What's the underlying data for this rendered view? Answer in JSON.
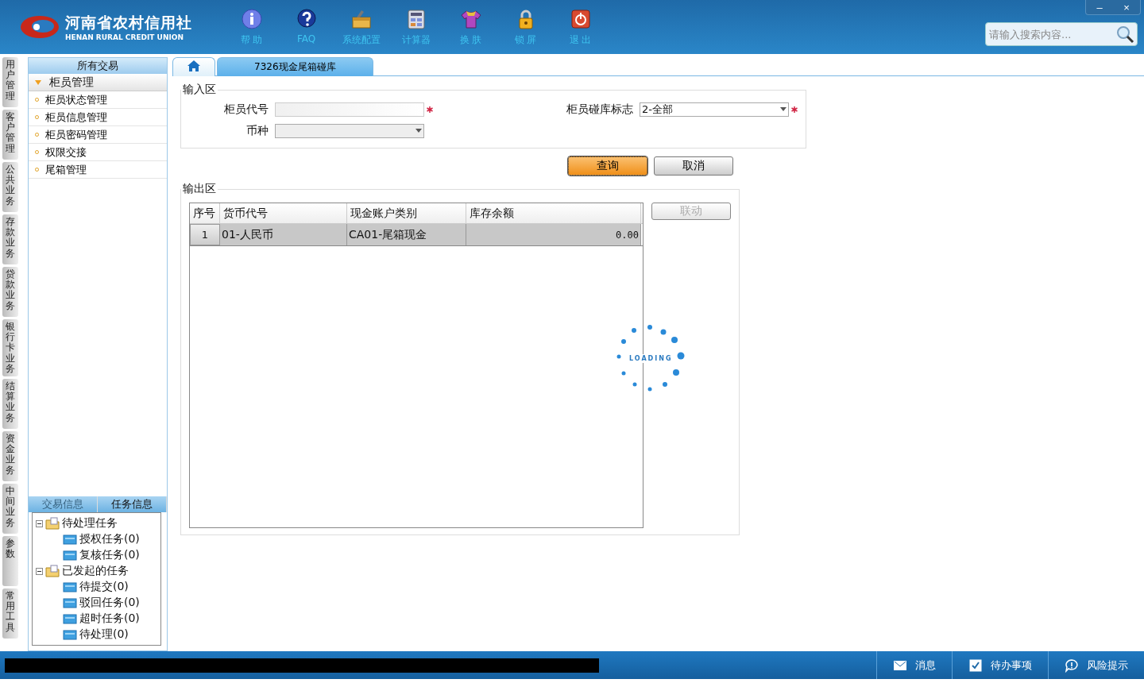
{
  "header": {
    "logo_title": "河南省农村信用社",
    "logo_subtitle": "HENAN RURAL CREDIT UNION",
    "toolbar": [
      {
        "kind": "info",
        "label": "帮 助"
      },
      {
        "kind": "faq",
        "label": "FAQ"
      },
      {
        "kind": "toolbox",
        "label": "系统配置"
      },
      {
        "kind": "calculator",
        "label": "计算器"
      },
      {
        "kind": "shirt",
        "label": "换 肤"
      },
      {
        "kind": "lock",
        "label": "锁 屏"
      },
      {
        "kind": "power",
        "label": "退 出"
      }
    ],
    "search": {
      "placeholder": "请输入搜索内容..."
    },
    "window_buttons": [
      "–",
      "×"
    ]
  },
  "side_tabs": [
    {
      "label": "用户管理",
      "selected": false
    },
    {
      "label": "客户管理",
      "selected": false
    },
    {
      "label": "公共业务",
      "selected": false
    },
    {
      "label": "存款业务",
      "selected": false
    },
    {
      "label": "贷款业务",
      "selected": false
    },
    {
      "label": "银行卡业务",
      "selected": false
    },
    {
      "label": "结算业务",
      "selected": false
    },
    {
      "label": "资金业务",
      "selected": false
    },
    {
      "label": "中间业务",
      "selected": false
    },
    {
      "label": "参数",
      "selected": false
    },
    {
      "label": "常用工具",
      "selected": false
    }
  ],
  "sidebar": {
    "title": "所有交易",
    "group": {
      "label": "柜员管理",
      "expanded": true,
      "items": [
        "柜员状态管理",
        "柜员信息管理",
        "柜员密码管理",
        "权限交接",
        "尾箱管理"
      ]
    },
    "panel_tabs": [
      {
        "label": "交易信息",
        "selected": false
      },
      {
        "label": "任务信息",
        "selected": true
      }
    ],
    "tree": [
      {
        "label": "待处理任务",
        "kind": "folder",
        "expanded": true,
        "children": [
          {
            "label": "授权任务(0)",
            "kind": "leaf"
          },
          {
            "label": "复核任务(0)",
            "kind": "leaf"
          }
        ]
      },
      {
        "label": "已发起的任务",
        "kind": "folder",
        "expanded": true,
        "children": [
          {
            "label": "待提交(0)",
            "kind": "leaf"
          },
          {
            "label": "驳回任务(0)",
            "kind": "leaf"
          },
          {
            "label": "超时任务(0)",
            "kind": "leaf"
          },
          {
            "label": "待处理(0)",
            "kind": "leaf"
          }
        ]
      }
    ]
  },
  "tabs": [
    {
      "kind": "home",
      "selected": false
    },
    {
      "kind": "page",
      "label": "7326现金尾箱碰库",
      "selected": true
    }
  ],
  "input_area": {
    "title": "输入区",
    "teller_code": {
      "label": "柜员代号",
      "required": true
    },
    "flag": {
      "label": "柜员碰库标志",
      "value": "2-全部",
      "required": true
    },
    "currency": {
      "label": "币种",
      "disabled": true
    }
  },
  "buttons": [
    {
      "label": "查询",
      "primary": true
    },
    {
      "label": "取消",
      "primary": false
    }
  ],
  "output_area": {
    "title": "输出区",
    "columns": [
      "序号",
      "货币代号",
      "现金账户类别",
      "库存余额"
    ],
    "rows": [
      {
        "cells": [
          "1",
          "01-人民币",
          "CA01-尾箱现金",
          "0.00"
        ],
        "selected": true
      }
    ],
    "link_button": {
      "label": "联动",
      "disabled": true
    },
    "loading": "LOADING"
  },
  "status_bar": [
    {
      "kind": "mail",
      "label": "消息"
    },
    {
      "kind": "check",
      "label": "待办事项"
    },
    {
      "kind": "chat",
      "label": "风险提示"
    }
  ]
}
